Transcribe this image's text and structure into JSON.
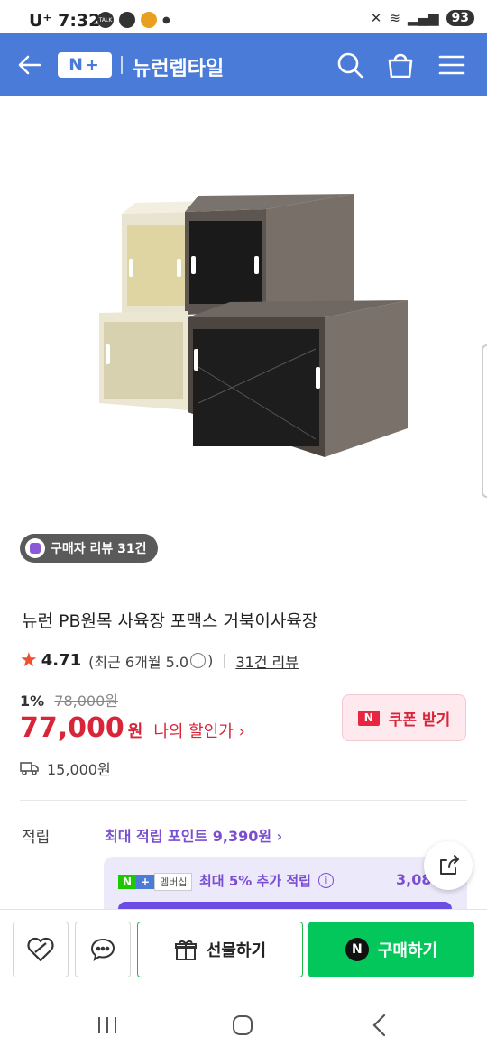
{
  "status_bar": {
    "carrier": "U⁺",
    "time": "7:32",
    "badge": "TALK",
    "battery": "93"
  },
  "header": {
    "logo_text": "N+",
    "store_name": "뉴런렙타일"
  },
  "review_badge": {
    "text": "구매자 리뷰 31건"
  },
  "product": {
    "title": "뉴런 PB원목 사육장 포맥스 거북이사육장",
    "rating": "4.71",
    "recent_rating": "(최근 6개월 5.0",
    "recent_close": ")",
    "review_link": "31건 리뷰",
    "discount_rate": "1%",
    "original_price": "78,000원",
    "price": "77,000",
    "won": "원",
    "my_discount": "나의 할인가 ›",
    "coupon_label": "쿠폰 받기",
    "shipping": "15,000원"
  },
  "points": {
    "label": "적립",
    "max_points": "최대 적립 포인트 9,390원 ›",
    "member_badge_n": "N",
    "member_badge_plus": "+",
    "member_badge_text": "멤버십",
    "member_text": "최대 5% 추가 적립",
    "member_amount": "3,08"
  },
  "bottom_bar": {
    "gift_label": "선물하기",
    "buy_label": "구매하기",
    "n_badge": "N"
  },
  "colors": {
    "header": "#4a7bd9",
    "price": "#d9253a",
    "buy": "#03c75a",
    "points": "#7a4ed1"
  }
}
